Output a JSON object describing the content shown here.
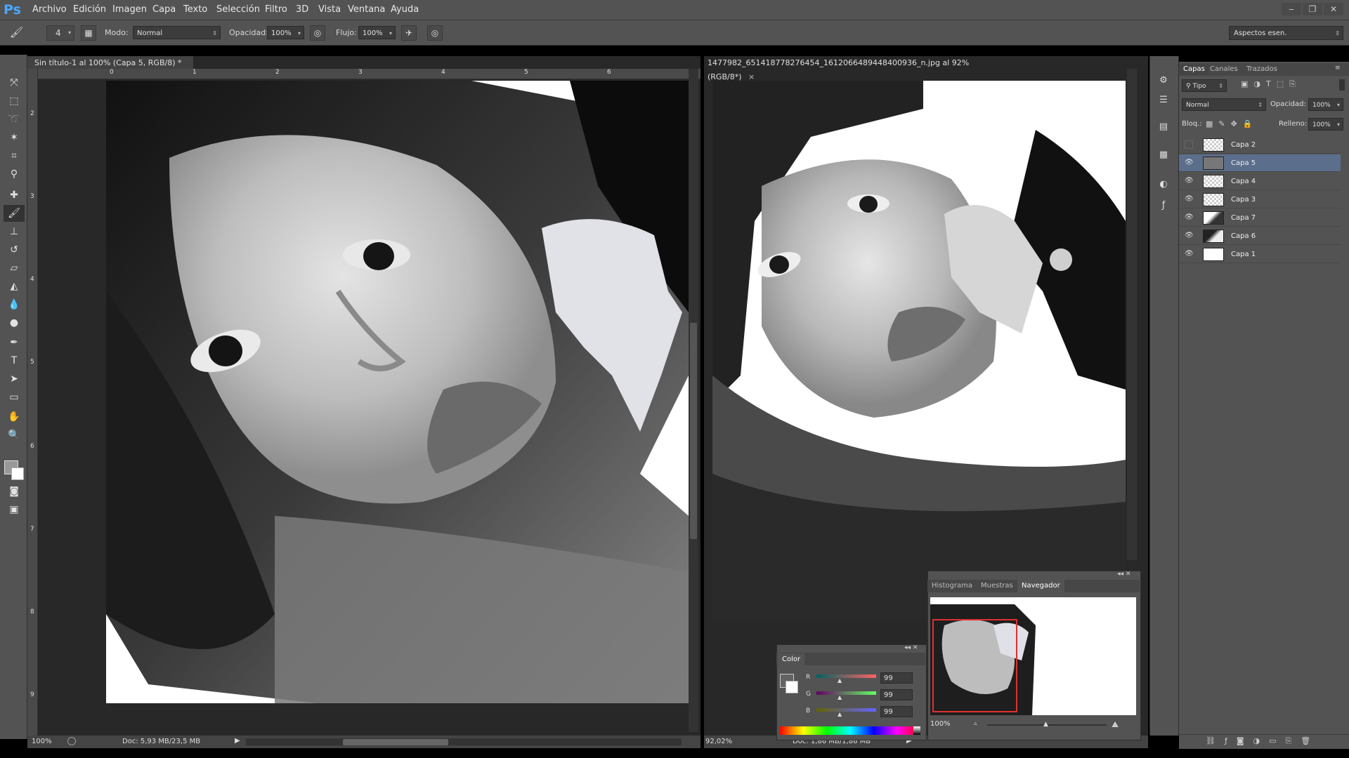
{
  "app": {
    "logo": "Ps"
  },
  "menu": [
    "Archivo",
    "Edición",
    "Imagen",
    "Capa",
    "Texto",
    "Selección",
    "Filtro",
    "3D",
    "Vista",
    "Ventana",
    "Ayuda"
  ],
  "window_controls": {
    "minimize": "‒",
    "restore": "❐",
    "close": "✕"
  },
  "options": {
    "brush_size": "4",
    "mode_label": "Modo:",
    "mode_value": "Normal",
    "opacity_label": "Opacidad:",
    "opacity_value": "100%",
    "flow_label": "Flujo:",
    "flow_value": "100%",
    "workspace": "Aspectos esen."
  },
  "documents": [
    {
      "tab": "Sin título-1 al 100% (Capa 5, RGB/8) *",
      "close": "×",
      "zoom": "100%",
      "doc_info": "Doc: 5,93 MB/23,5 MB",
      "ruler_h": [
        "0",
        "1",
        "2",
        "3",
        "4",
        "5",
        "6"
      ],
      "ruler_v": [
        "2",
        "3",
        "4",
        "5",
        "6",
        "7",
        "8",
        "9"
      ]
    },
    {
      "tab": "1477982_651418778276454_1612066489448400936_n.jpg al 92% (RGB/8*)",
      "close": "×",
      "zoom": "92,02%",
      "doc_info": "Doc: 1,86 MB/1,86 MB"
    }
  ],
  "layers_panel": {
    "tabs": [
      "Capas",
      "Canales",
      "Trazados"
    ],
    "filter": "Tipo",
    "blend": "Normal",
    "opacity_label": "Opacidad:",
    "opacity_value": "100%",
    "lock_label": "Bloq.:",
    "fill_label": "Relleno:",
    "fill_value": "100%",
    "layers": [
      {
        "name": "Capa 2",
        "visible": false,
        "selected": false
      },
      {
        "name": "Capa 5",
        "visible": true,
        "selected": true
      },
      {
        "name": "Capa 4",
        "visible": true,
        "selected": false
      },
      {
        "name": "Capa 3",
        "visible": true,
        "selected": false
      },
      {
        "name": "Capa 7",
        "visible": true,
        "selected": false
      },
      {
        "name": "Capa 6",
        "visible": true,
        "selected": false
      },
      {
        "name": "Capa 1",
        "visible": true,
        "selected": false
      }
    ]
  },
  "navigator_panel": {
    "tabs": [
      "Histograma",
      "Muestras",
      "Navegador"
    ],
    "active_tab": "Navegador",
    "zoom": "100%"
  },
  "color_panel": {
    "title": "Color",
    "channels": [
      {
        "label": "R",
        "value": "99"
      },
      {
        "label": "G",
        "value": "99"
      },
      {
        "label": "B",
        "value": "99"
      }
    ]
  },
  "colors": {
    "accent": "#4aa8ff",
    "selected_layer": "#5b6e8c",
    "nav_box": "#e03030"
  }
}
